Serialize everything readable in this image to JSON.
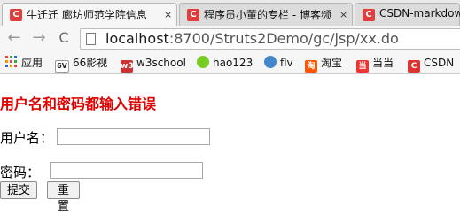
{
  "tabs": [
    {
      "icon": "C",
      "title": "牛迁迁 廊坊师范学院信息",
      "close": "×"
    },
    {
      "icon": "C",
      "title": "程序员小董的专栏 - 博客频",
      "close": "×"
    },
    {
      "icon": "C",
      "title": "CSDN-markdown"
    }
  ],
  "toolbar": {
    "back": "←",
    "forward": "→",
    "reload": "C",
    "url_host": "localhost",
    "url_path": ":8700/Struts2Demo/gc/jsp/xx.do"
  },
  "bookmarks": [
    {
      "icon": "apps-icon",
      "label": "应用"
    },
    {
      "icon": "6v-icon",
      "badge": "6V",
      "label": "66影视"
    },
    {
      "icon": "w3-icon",
      "badge": "w3",
      "label": "w3school"
    },
    {
      "icon": "hao123-icon",
      "label": "hao123"
    },
    {
      "icon": "flv-icon",
      "label": "flv"
    },
    {
      "icon": "taobao-icon",
      "badge": "淘",
      "label": "淘宝"
    },
    {
      "icon": "dangdang-icon",
      "badge": "当",
      "label": "当当"
    },
    {
      "icon": "csdn-icon",
      "badge": "C",
      "label": "CSDN"
    }
  ],
  "form": {
    "error_message": "用户名和密码都输入错误",
    "username_label": "用户名：",
    "username_value": "",
    "password_label": "密码：",
    "password_value": "",
    "submit_label": "提交",
    "reset_label": "重置"
  },
  "colors": {
    "error": "#e00000",
    "favicon": "#e03d3d"
  }
}
